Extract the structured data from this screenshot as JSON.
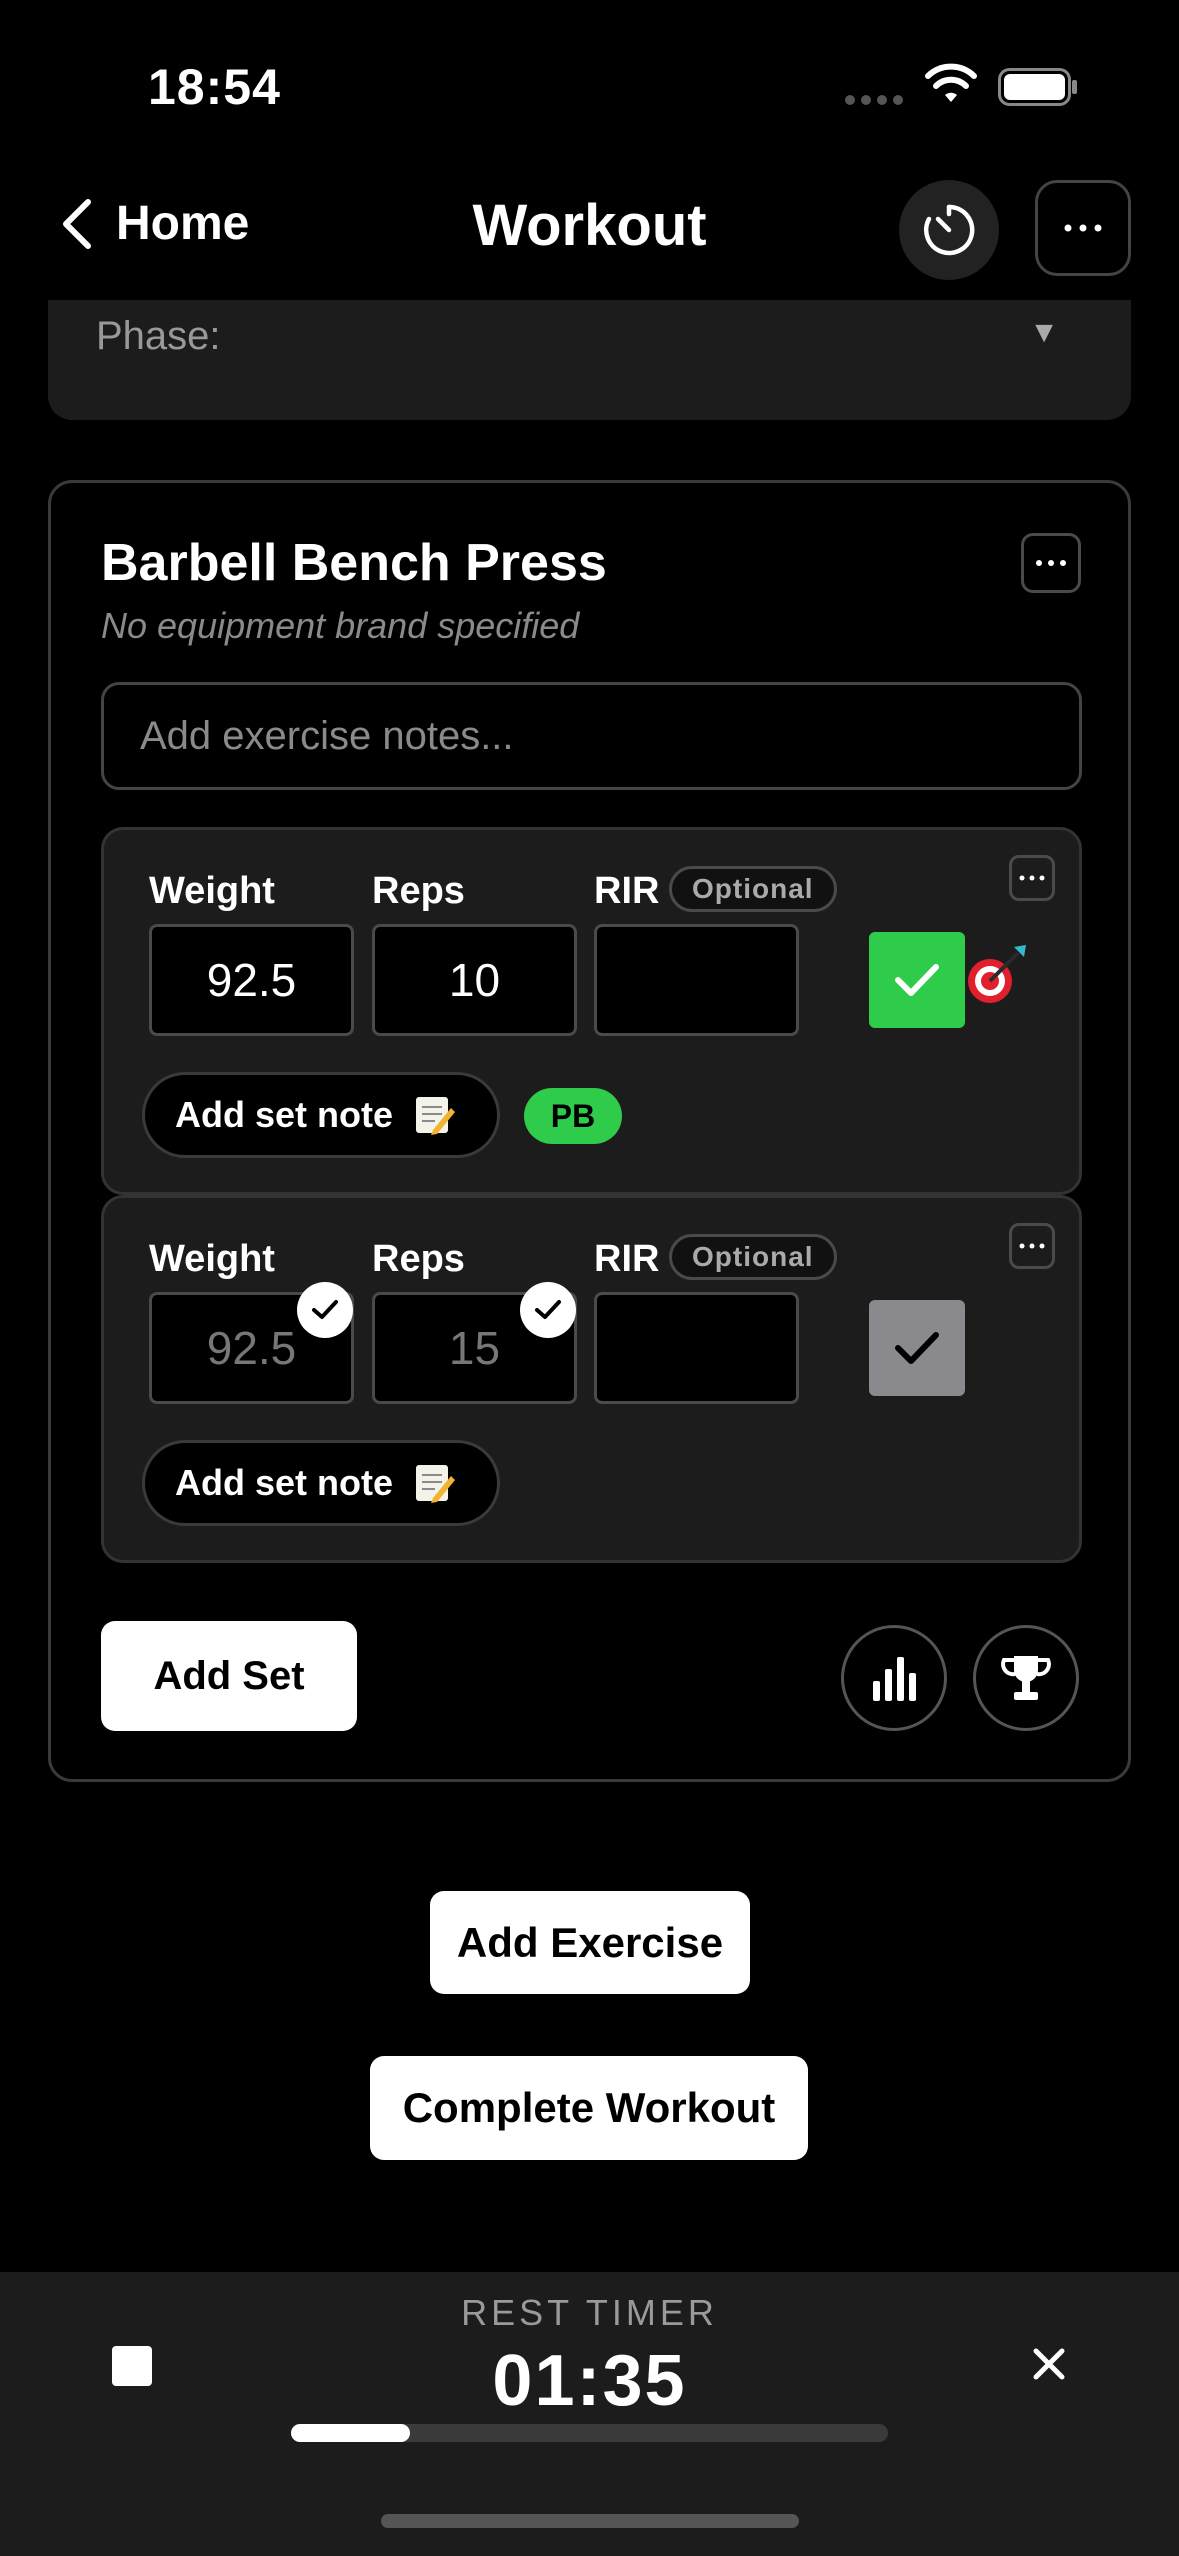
{
  "status_bar": {
    "time": "18:54"
  },
  "nav": {
    "back_label": "Home",
    "title": "Workout"
  },
  "phase": {
    "label": "Phase:"
  },
  "exercise": {
    "title": "Barbell Bench Press",
    "subtitle": "No equipment brand specified",
    "notes_placeholder": "Add exercise notes...",
    "sets": [
      {
        "weight_label": "Weight",
        "reps_label": "Reps",
        "rir_label": "RIR",
        "optional_label": "Optional",
        "weight": "92.5",
        "reps": "10",
        "rir": "",
        "completed": true,
        "note_label": "Add set note",
        "badge": "PB"
      },
      {
        "weight_label": "Weight",
        "reps_label": "Reps",
        "rir_label": "RIR",
        "optional_label": "Optional",
        "weight": "92.5",
        "reps": "15",
        "rir": "",
        "completed": false,
        "note_label": "Add set note"
      }
    ],
    "add_set_label": "Add Set"
  },
  "actions": {
    "add_exercise": "Add Exercise",
    "complete_workout": "Complete Workout"
  },
  "rest_timer": {
    "label": "REST TIMER",
    "time": "01:35",
    "progress": 0.2
  },
  "colors": {
    "accent_green": "#2ecc4a",
    "completed_gray": "#8a8a8e"
  }
}
